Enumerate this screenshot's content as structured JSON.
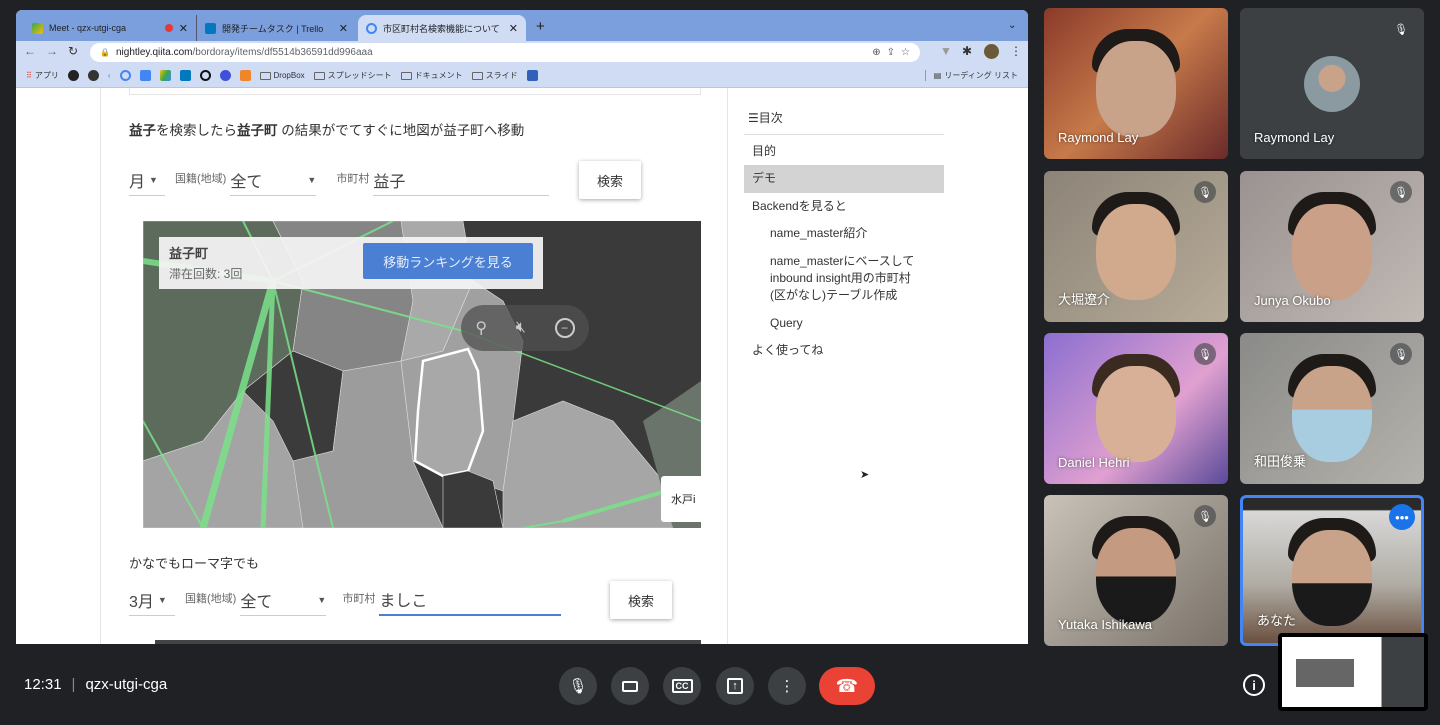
{
  "browser": {
    "tabs": [
      {
        "label": "Meet - qzx-utgi-cga",
        "icon": "meet-icon",
        "recording": true
      },
      {
        "label": "開発チームタスク | Trello",
        "icon": "trello-icon"
      },
      {
        "label": "市区町村名検索機能について (nam",
        "icon": "qiita-icon"
      }
    ],
    "url_host": "nightley.qiita.com",
    "url_path": "/bordoray/items/df5514b36591dd996aaa",
    "bookmarks": {
      "apps": "アプリ",
      "folders": [
        "DropBox",
        "スプレッドシート",
        "ドキュメント",
        "スライド"
      ],
      "reading_list": "リーディング リスト"
    }
  },
  "article": {
    "heading1_bold1": "益子",
    "heading1_mid": "を検索したら",
    "heading1_bold2": "益子町",
    "heading1_rest": " の結果がでてすぐに地図が益子町へ移動",
    "form1": {
      "month": "月",
      "nationality_label": "国籍(地域)",
      "nationality_value": "全て",
      "city_label": "市町村",
      "city_value": "益子",
      "search": "検索"
    },
    "map": {
      "town": "益子町",
      "stay_count": "滞在回数: 3回",
      "ranking_button": "移動ランキングを見る",
      "side_label": "水戸i"
    },
    "heading2": "かなでもローマ字でも",
    "form2": {
      "month": "3月",
      "nationality_label": "国籍(地域)",
      "nationality_value": "全て",
      "city_label": "市町村",
      "city_value": "ましこ",
      "search": "検索"
    }
  },
  "toc": {
    "title": "目次",
    "items": [
      {
        "label": "目的",
        "level": 1
      },
      {
        "label": "デモ",
        "level": 1,
        "active": true
      },
      {
        "label": "Backendを見ると",
        "level": 1
      },
      {
        "label": "name_master紹介",
        "level": 2
      },
      {
        "label": "name_masterにベースして inbound insight用の市町村 (区がなし)テーブル作成",
        "level": 2
      },
      {
        "label": "Query",
        "level": 2
      },
      {
        "label": "よく使ってね",
        "level": 1
      }
    ]
  },
  "participants": [
    {
      "name": "Raymond Lay",
      "muted": false
    },
    {
      "name": "Raymond Lay",
      "muted": true
    },
    {
      "name": "大堀遼介",
      "muted": true
    },
    {
      "name": "Junya Okubo",
      "muted": true
    },
    {
      "name": "Daniel Hehri",
      "muted": true
    },
    {
      "name": "和田俊乗",
      "muted": true
    },
    {
      "name": "Yutaka Ishikawa",
      "muted": true
    },
    {
      "name": "あなた",
      "muted": false
    }
  ],
  "meeting": {
    "time": "12:31",
    "code": "qzx-utgi-cga"
  },
  "colors": {
    "hangup": "#ea4335",
    "accent": "#4a7fd4",
    "self_border": "#4285f4"
  }
}
